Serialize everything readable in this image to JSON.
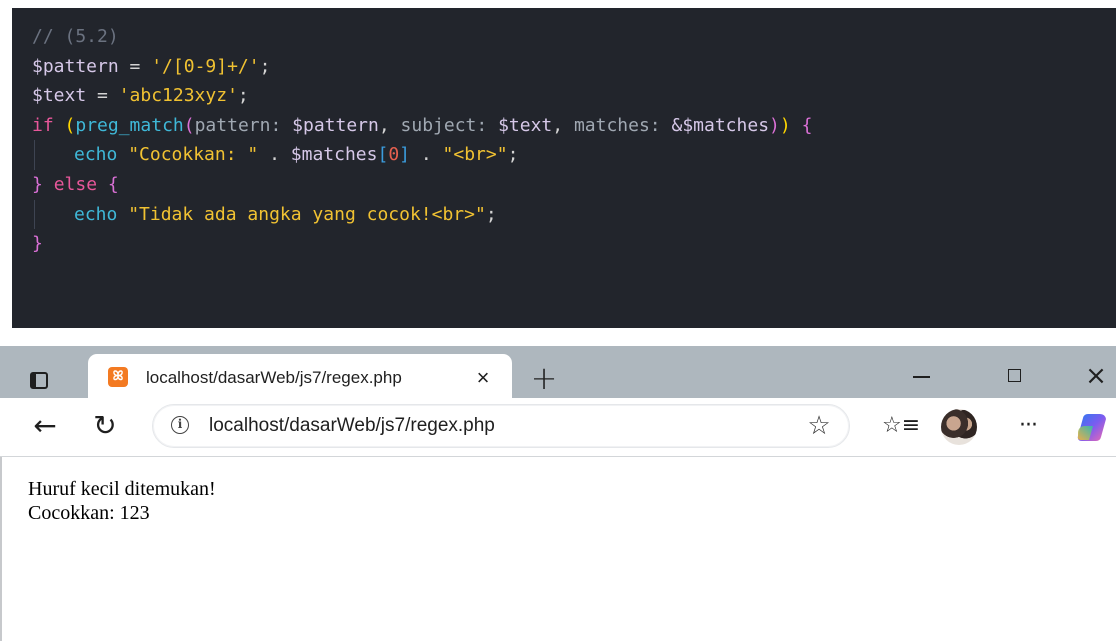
{
  "code": {
    "comment": "// (5.2)",
    "pattern_var": "$pattern",
    "pattern_value": "'/[0-9]+/'",
    "text_var": "$text",
    "text_value": "'abc123xyz'",
    "if_kw": "if",
    "func_name": "preg_match",
    "param_pattern": "pattern:",
    "param_subject": "subject:",
    "param_matches": "matches:",
    "matches_ref": "&$matches",
    "echo_kw": "echo",
    "echo_str1": "\"Cocokkan: \"",
    "dot": ".",
    "matches_var": "$matches",
    "index": "0",
    "br_str": "\"<br>\"",
    "else_kw": "else",
    "echo_str2": "\"Tidak ada angka yang cocok!<br>\""
  },
  "browser": {
    "tab_title": "localhost/dasarWeb/js7/regex.php",
    "url": "localhost/dasarWeb/js7/regex.php",
    "new_tab_glyph": "+",
    "close_glyph": "×",
    "page_lines": [
      "Huruf kecil ditemukan!",
      "Cocokkan: 123"
    ]
  },
  "colors": {
    "editor_bg": "#22252c",
    "tabstrip_bg": "#aeb7be",
    "string": "#f1c232",
    "keyword": "#e8579a",
    "function": "#3fb8d8"
  }
}
